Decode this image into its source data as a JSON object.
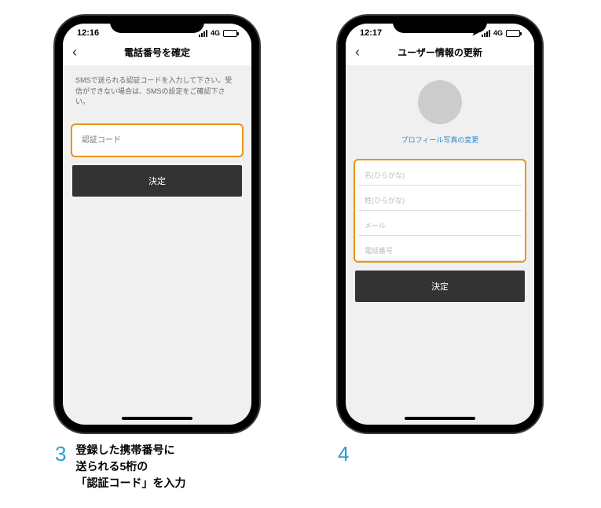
{
  "screen1": {
    "status_time": "12:16",
    "network_label": "4G",
    "nav_title": "電話番号を確定",
    "instruction": "SMSで送られる認証コードを入力して下さい。受信ができない場合は、SMSの設定をご確認下さい。",
    "code_placeholder": "認証コード",
    "submit_label": "決定"
  },
  "screen2": {
    "status_time": "12:17",
    "network_label": "4G",
    "nav_title": "ユーザー情報の更新",
    "avatar_link": "プロフィール写真の変更",
    "fields": {
      "first_name": "名(ひらがな)",
      "last_name": "姓(ひらがな)",
      "email": "メール",
      "phone": "電話番号"
    },
    "submit_label": "決定"
  },
  "steps": {
    "num1": "3",
    "text1": "登録した携帯番号に\n送られる5桁の\n「認証コード」を入力",
    "num2": "4"
  }
}
